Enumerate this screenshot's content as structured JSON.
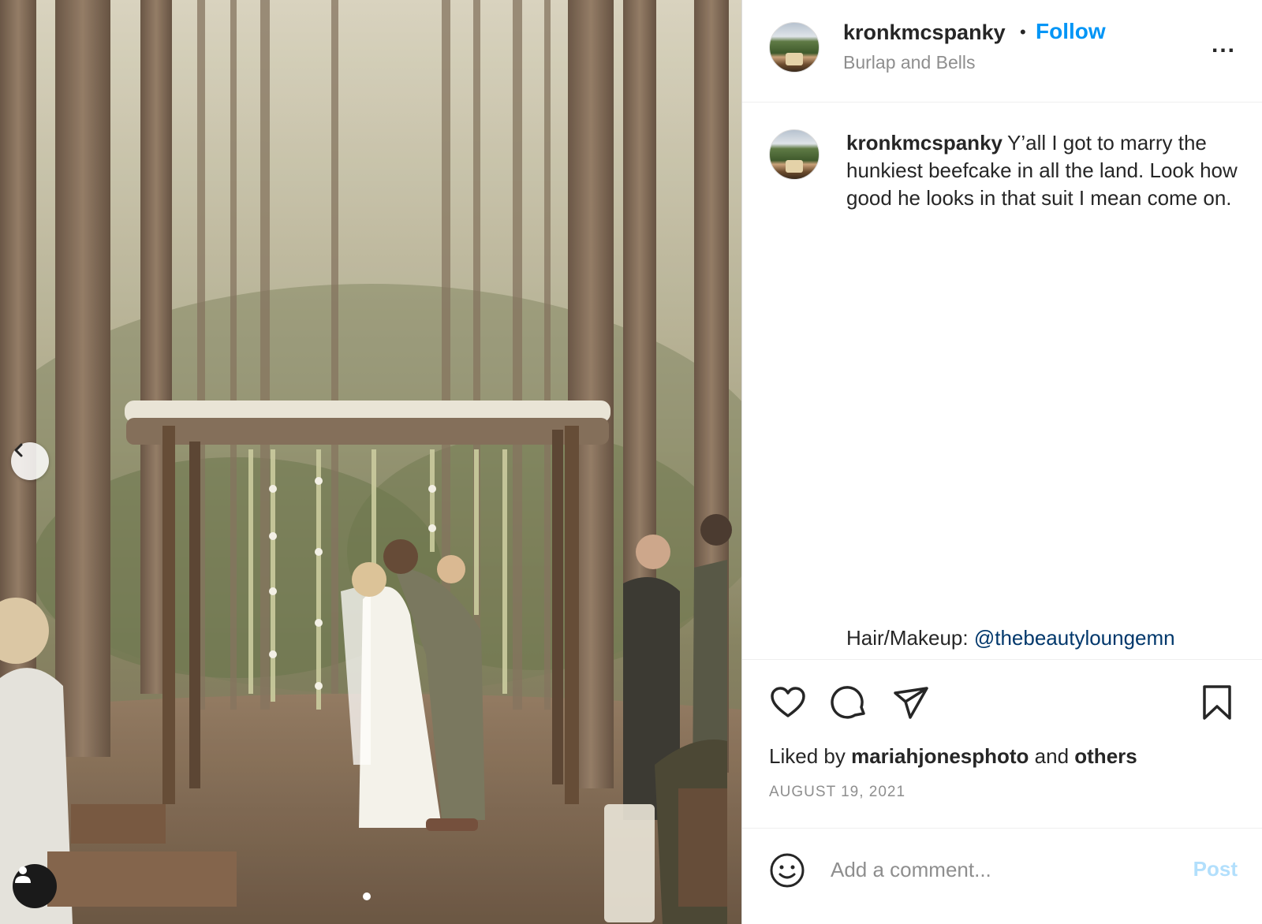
{
  "photo": {
    "nav": {
      "prev_icon": "chevron-left-icon"
    },
    "tag_icon": "person-icon",
    "carousel": {
      "count": 2,
      "active_index": 1
    }
  },
  "header": {
    "username": "kronkmcspanky",
    "separator": "•",
    "follow_label": "Follow",
    "location": "Burlap and Bells",
    "more_label": "..."
  },
  "caption": {
    "username": "kronkmcspanky",
    "text": "Y’all I got to marry the hunkiest beefcake in all the land. Look how good he looks in that suit I mean come on.",
    "credits_label": "Hair/Makeup: ",
    "credits_mention": "@thebeautyloungemn"
  },
  "actions": {
    "like_icon": "heart-icon",
    "comment_icon": "comment-icon",
    "share_icon": "paper-plane-icon",
    "save_icon": "bookmark-icon"
  },
  "likes": {
    "prefix": "Liked by ",
    "user": "mariahjonesphoto",
    "middle": " and ",
    "others": "others"
  },
  "date": "AUGUST 19, 2021",
  "comment": {
    "placeholder": "Add a comment...",
    "post_label": "Post",
    "emoji_icon": "smiley-icon"
  },
  "colors": {
    "accent": "#0095f6",
    "mention": "#00376b",
    "post_disabled": "#b2dffc",
    "muted": "#8e8e8e"
  }
}
